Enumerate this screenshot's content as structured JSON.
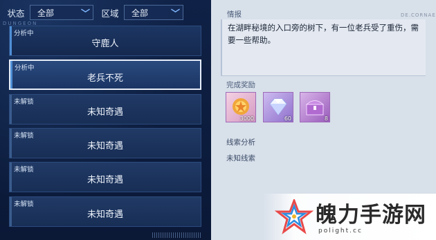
{
  "filters": {
    "status_label": "状态",
    "status_value": "全部",
    "region_label": "区域",
    "region_value": "全部"
  },
  "dungeon_tag": "DUNGEON",
  "quests": [
    {
      "status": "分析中",
      "title": "守鹿人"
    },
    {
      "status": "分析中",
      "title": "老兵不死"
    },
    {
      "status": "未解锁",
      "title": "未知奇遇"
    },
    {
      "status": "未解锁",
      "title": "未知奇遇"
    },
    {
      "status": "未解锁",
      "title": "未知奇遇"
    },
    {
      "status": "未解锁",
      "title": "未知奇遇"
    }
  ],
  "detail": {
    "info_title": "情报",
    "info_tag": "DE.CORNAE",
    "info_text": "在湖畔秘境的入口旁的树下，有一位老兵受了重伤，需要一些帮助。",
    "reward_title": "完成奖励",
    "rewards": [
      {
        "icon": "gold-coin-icon",
        "count": "3000"
      },
      {
        "icon": "diamond-icon",
        "count": "60"
      },
      {
        "icon": "treasure-chest-icon",
        "count": "8"
      }
    ],
    "clue_title": "线索分析",
    "clue_text": "未知线索"
  },
  "watermark": {
    "text": "魄力手游网",
    "url": "polight.cc"
  },
  "colors": {
    "accent_blue": "#4f8fd6",
    "panel_dark": "#0f2146",
    "panel_light": "#d8e0ea",
    "reward_border": "#9e6ab8"
  }
}
